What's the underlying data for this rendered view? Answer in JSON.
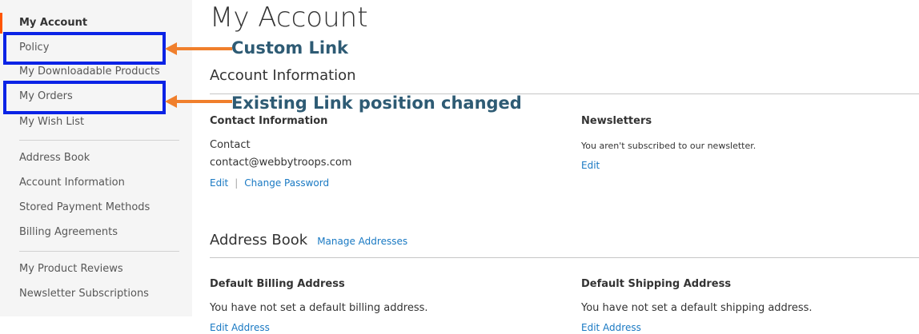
{
  "sidebar": {
    "current": "My Account",
    "items": [
      {
        "label": "Policy"
      },
      {
        "label": "My Downloadable Products"
      },
      {
        "label": "My Orders"
      },
      {
        "label": "My Wish List"
      },
      {
        "label": "Address Book"
      },
      {
        "label": "Account Information"
      },
      {
        "label": "Stored Payment Methods"
      },
      {
        "label": "Billing Agreements"
      },
      {
        "label": "My Product Reviews"
      },
      {
        "label": "Newsletter Subscriptions"
      }
    ]
  },
  "annotations": {
    "custom_link": "Custom Link",
    "position_changed": "Existing Link position changed",
    "box_color": "#0a23e6",
    "arrow_color": "#f07f2c",
    "text_color": "#2e5b74"
  },
  "main": {
    "page_title": "My Account",
    "account_information": {
      "title": "Account Information",
      "contact": {
        "title": "Contact Information",
        "name": "Contact",
        "email": "contact@webbytroops.com",
        "edit": "Edit",
        "separator": "|",
        "change_password": "Change Password"
      },
      "newsletters": {
        "title": "Newsletters",
        "status": "You aren't subscribed to our newsletter.",
        "edit": "Edit"
      }
    },
    "address_book": {
      "title": "Address Book",
      "manage": "Manage Addresses",
      "billing": {
        "title": "Default Billing Address",
        "text": "You have not set a default billing address.",
        "edit": "Edit Address"
      },
      "shipping": {
        "title": "Default Shipping Address",
        "text": "You have not set a default shipping address.",
        "edit": "Edit Address"
      }
    }
  },
  "colors": {
    "accent": "#ff5501",
    "link": "#1979c3",
    "sidebar_bg": "#f5f5f5"
  }
}
